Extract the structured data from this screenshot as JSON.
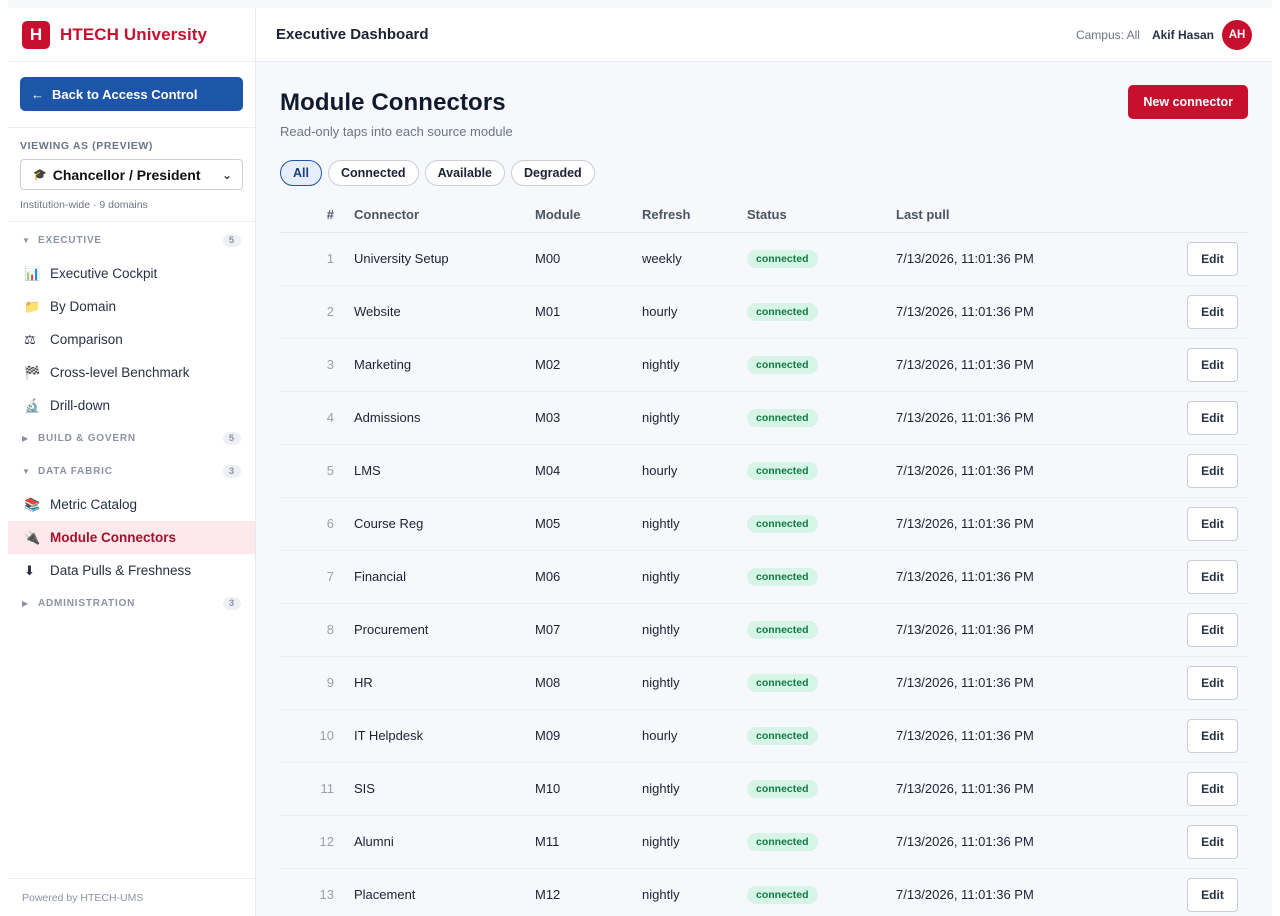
{
  "brand": {
    "logo_letter": "H",
    "name": "HTECH University"
  },
  "sidebar": {
    "back_label": "Back to Access Control",
    "back_arrow": "←",
    "viewing_label": "VIEWING AS (PREVIEW)",
    "role_icon": "🎓",
    "role": "Chancellor / President",
    "role_sub": "Institution-wide · 9 domains",
    "sections": [
      {
        "title": "EXECUTIVE",
        "count": "5",
        "expanded": true
      },
      {
        "title": "BUILD & GOVERN",
        "count": "5",
        "expanded": false
      },
      {
        "title": "DATA FABRIC",
        "count": "3",
        "expanded": true
      },
      {
        "title": "ADMINISTRATION",
        "count": "3",
        "expanded": false
      }
    ],
    "executive_items": [
      {
        "icon": "📊",
        "label": "Executive Cockpit"
      },
      {
        "icon": "📁",
        "label": "By Domain"
      },
      {
        "icon": "⚖",
        "label": "Comparison"
      },
      {
        "icon": "🏁",
        "label": "Cross-level Benchmark"
      },
      {
        "icon": "🔬",
        "label": "Drill-down"
      }
    ],
    "data_fabric_items": [
      {
        "icon": "📚",
        "label": "Metric Catalog"
      },
      {
        "icon": "🔌",
        "label": "Module Connectors",
        "active": true
      },
      {
        "icon": "⬇",
        "label": "Data Pulls & Freshness"
      }
    ],
    "footer": "Powered by HTECH-UMS"
  },
  "topbar": {
    "title": "Executive Dashboard",
    "campus": "Campus: All",
    "user_name": "Akif Hasan",
    "user_initials": "AH"
  },
  "page": {
    "title": "Module Connectors",
    "subtitle": "Read-only taps into each source module",
    "new_button": "New connector",
    "filters": [
      "All",
      "Connected",
      "Available",
      "Degraded"
    ],
    "active_filter": "All"
  },
  "table": {
    "headers": {
      "num": "#",
      "connector": "Connector",
      "module": "Module",
      "refresh": "Refresh",
      "status": "Status",
      "last_pull": "Last pull"
    },
    "edit_label": "Edit",
    "rows": [
      {
        "num": "1",
        "connector": "University Setup",
        "module": "M00",
        "refresh": "weekly",
        "status": "connected",
        "last_pull": "7/13/2026, 11:01:36 PM"
      },
      {
        "num": "2",
        "connector": "Website",
        "module": "M01",
        "refresh": "hourly",
        "status": "connected",
        "last_pull": "7/13/2026, 11:01:36 PM"
      },
      {
        "num": "3",
        "connector": "Marketing",
        "module": "M02",
        "refresh": "nightly",
        "status": "connected",
        "last_pull": "7/13/2026, 11:01:36 PM"
      },
      {
        "num": "4",
        "connector": "Admissions",
        "module": "M03",
        "refresh": "nightly",
        "status": "connected",
        "last_pull": "7/13/2026, 11:01:36 PM"
      },
      {
        "num": "5",
        "connector": "LMS",
        "module": "M04",
        "refresh": "hourly",
        "status": "connected",
        "last_pull": "7/13/2026, 11:01:36 PM"
      },
      {
        "num": "6",
        "connector": "Course Reg",
        "module": "M05",
        "refresh": "nightly",
        "status": "connected",
        "last_pull": "7/13/2026, 11:01:36 PM"
      },
      {
        "num": "7",
        "connector": "Financial",
        "module": "M06",
        "refresh": "nightly",
        "status": "connected",
        "last_pull": "7/13/2026, 11:01:36 PM"
      },
      {
        "num": "8",
        "connector": "Procurement",
        "module": "M07",
        "refresh": "nightly",
        "status": "connected",
        "last_pull": "7/13/2026, 11:01:36 PM"
      },
      {
        "num": "9",
        "connector": "HR",
        "module": "M08",
        "refresh": "nightly",
        "status": "connected",
        "last_pull": "7/13/2026, 11:01:36 PM"
      },
      {
        "num": "10",
        "connector": "IT Helpdesk",
        "module": "M09",
        "refresh": "hourly",
        "status": "connected",
        "last_pull": "7/13/2026, 11:01:36 PM"
      },
      {
        "num": "11",
        "connector": "SIS",
        "module": "M10",
        "refresh": "nightly",
        "status": "connected",
        "last_pull": "7/13/2026, 11:01:36 PM"
      },
      {
        "num": "12",
        "connector": "Alumni",
        "module": "M11",
        "refresh": "nightly",
        "status": "connected",
        "last_pull": "7/13/2026, 11:01:36 PM"
      },
      {
        "num": "13",
        "connector": "Placement",
        "module": "M12",
        "refresh": "nightly",
        "status": "connected",
        "last_pull": "7/13/2026, 11:01:36 PM"
      }
    ]
  },
  "colors": {
    "brand": "#c8102e",
    "primary": "#1d56a8",
    "status_connected_bg": "#d6f5e6",
    "status_connected_text": "#127a45"
  }
}
